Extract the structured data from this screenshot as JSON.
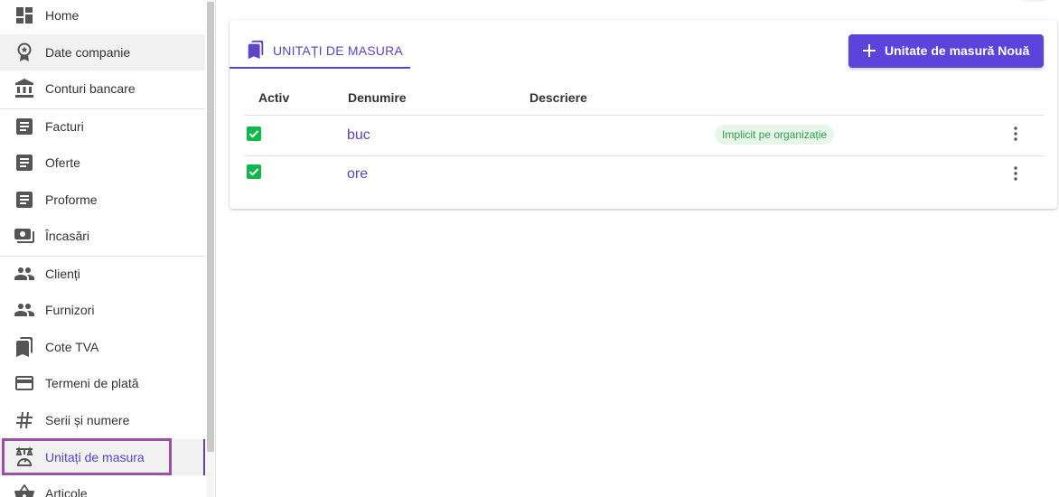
{
  "sidebar": {
    "items": [
      {
        "label": "Home",
        "icon": "dashboard-icon"
      },
      {
        "label": "Date companie",
        "icon": "award-icon"
      },
      {
        "label": "Conturi bancare",
        "icon": "bank-icon"
      },
      {
        "label": "Facturi",
        "icon": "document-icon"
      },
      {
        "label": "Oferte",
        "icon": "document-icon"
      },
      {
        "label": "Proforme",
        "icon": "document-icon"
      },
      {
        "label": "Încasări",
        "icon": "payments-icon"
      },
      {
        "label": "Clienți",
        "icon": "people-icon"
      },
      {
        "label": "Furnizori",
        "icon": "people-icon"
      },
      {
        "label": "Cote TVA",
        "icon": "bookmarks-icon"
      },
      {
        "label": "Termeni de plată",
        "icon": "credit-card-icon"
      },
      {
        "label": "Serii și numere",
        "icon": "hashtag-icon"
      },
      {
        "label": "Unitați de masura",
        "icon": "scale-icon"
      },
      {
        "label": "Articole",
        "icon": "basket-icon"
      }
    ]
  },
  "main": {
    "tab_label": "UNITAȚI DE MASURA",
    "new_button_label": "Unitate de masură Nouă",
    "columns": {
      "active": "Activ",
      "name": "Denumire",
      "description": "Descriere"
    },
    "rows": [
      {
        "name": "buc",
        "description": "",
        "badge": "Implicit pe organizație",
        "active": true
      },
      {
        "name": "ore",
        "description": "",
        "badge": "",
        "active": true
      }
    ]
  },
  "colors": {
    "accent": "#5c43c7",
    "button": "#5c43dc",
    "check": "#10b84a",
    "badge_bg": "#e8f5e9",
    "badge_text": "#2e9e48",
    "highlight": "#9c4fa8"
  }
}
